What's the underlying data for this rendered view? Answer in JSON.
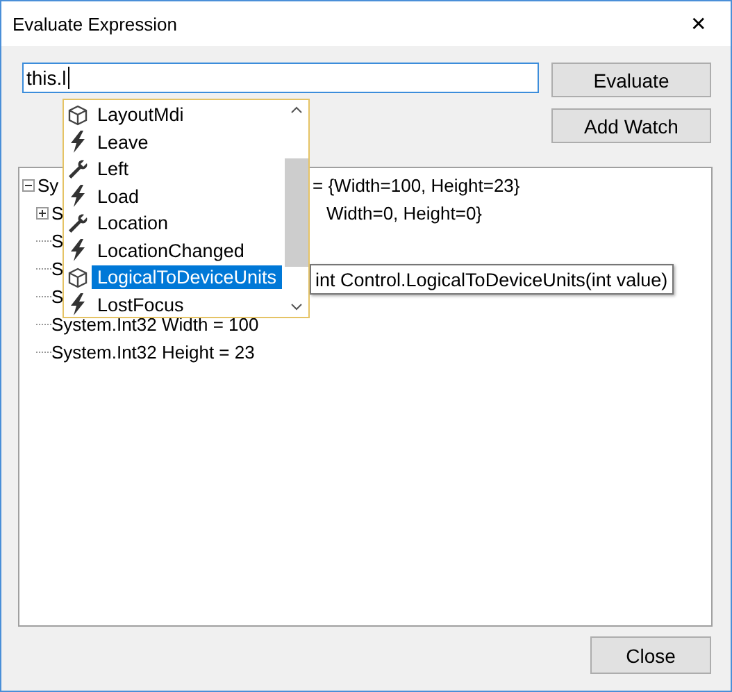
{
  "window": {
    "title": "Evaluate Expression",
    "close": "✕"
  },
  "expression": {
    "value": "this.l"
  },
  "buttons": {
    "evaluate": "Evaluate",
    "add_watch": "Add Watch",
    "close": "Close"
  },
  "completion": {
    "items": [
      {
        "label": "LayoutMdi",
        "kind": "method",
        "selected": false
      },
      {
        "label": "Leave",
        "kind": "event",
        "selected": false
      },
      {
        "label": "Left",
        "kind": "property",
        "selected": false
      },
      {
        "label": "Load",
        "kind": "event",
        "selected": false
      },
      {
        "label": "Location",
        "kind": "property",
        "selected": false
      },
      {
        "label": "LocationChanged",
        "kind": "event",
        "selected": false
      },
      {
        "label": "LogicalToDeviceUnits",
        "kind": "method",
        "selected": true
      },
      {
        "label": "LostFocus",
        "kind": "event",
        "selected": false
      }
    ],
    "tooltip": "int Control.LogicalToDeviceUnits(int value)"
  },
  "tree": {
    "nodes": [
      {
        "text": "Sy",
        "value": "= {Width=100, Height=23}",
        "expanded": true,
        "children": [
          {
            "text": "S",
            "value": "Width=0, Height=0}",
            "expanded": false
          },
          {
            "text": "S"
          },
          {
            "text": "S"
          },
          {
            "text": "S"
          },
          {
            "text": "System.Int32 Width = 100"
          },
          {
            "text": "System.Int32 Height = 23"
          }
        ]
      }
    ]
  }
}
